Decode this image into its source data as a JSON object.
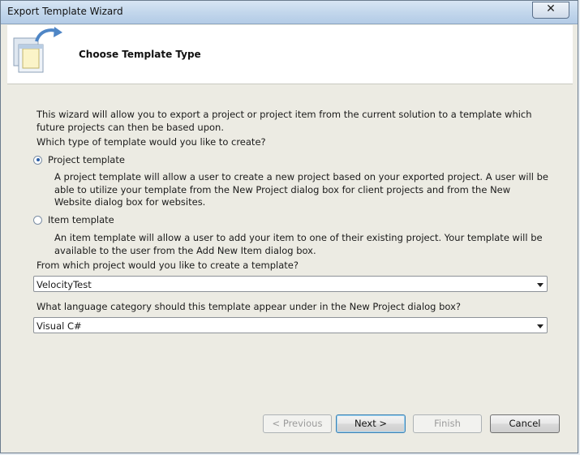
{
  "window": {
    "title": "Export Template Wizard",
    "close_glyph": "✕"
  },
  "header": {
    "title": "Choose Template Type",
    "icon": "export-template-icon"
  },
  "intro": "This wizard will allow you to export a project or project item from the current solution to a template which future projects can then be based upon.",
  "question_type": "Which type of template would you like to create?",
  "options": [
    {
      "label": "Project template",
      "checked": true,
      "description": "A project template will allow a user to create a new project based on your exported project. A user will be able to utilize your template from the New Project dialog box for client projects and from the New Website dialog box for websites."
    },
    {
      "label": "Item template",
      "checked": false,
      "description": "An item template will allow a user to add your item to one of their existing project. Your template will be available to the user from the Add New Item dialog box."
    }
  ],
  "project_question": "From which project would you like to create a template?",
  "project_select": {
    "value": "VelocityTest"
  },
  "language_question": "What language category should this template appear under in the New Project dialog box?",
  "language_select": {
    "value": "Visual C#"
  },
  "buttons": {
    "previous": "< Previous",
    "next": "Next >",
    "finish": "Finish",
    "cancel": "Cancel"
  }
}
